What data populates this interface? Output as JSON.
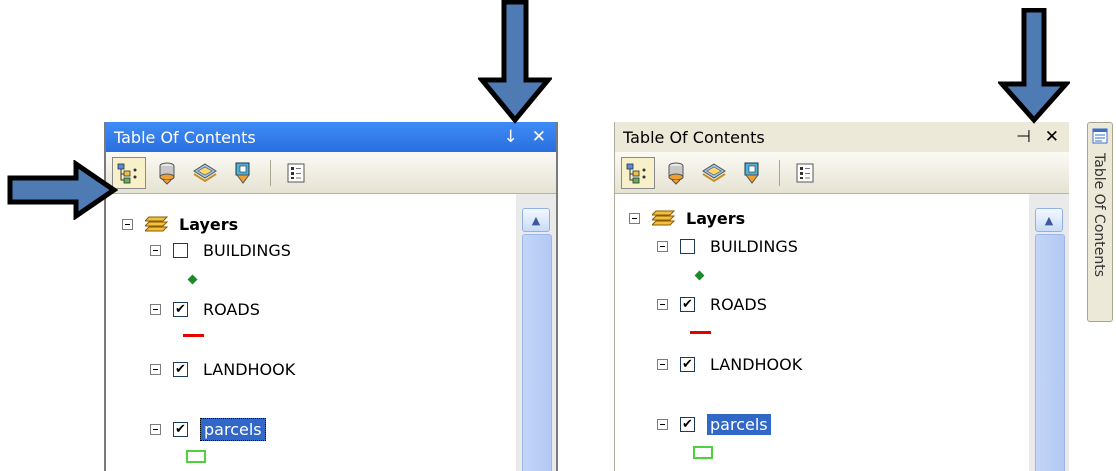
{
  "left_panel": {
    "title": "Table Of Contents",
    "pin_glyph": "↓",
    "close_glyph": "✕",
    "toolbar": [
      "list-by-drawing-order-icon",
      "list-by-source-icon",
      "list-by-visibility-icon",
      "list-by-selection-icon",
      "options-icon"
    ],
    "tree": {
      "root_label": "Layers",
      "layers": [
        {
          "name": "BUILDINGS",
          "checked": false,
          "symbol": "point",
          "symbol_color": "#1b8a2a"
        },
        {
          "name": "ROADS",
          "checked": true,
          "symbol": "line",
          "symbol_color": "#e60000"
        },
        {
          "name": "LANDHOOK",
          "checked": true,
          "symbol": "none"
        },
        {
          "name": "parcels",
          "checked": true,
          "symbol": "polygon",
          "symbol_color": "#4fd13c"
        }
      ]
    },
    "check_glyph": "✔"
  },
  "right_panel": {
    "title": "Table Of Contents",
    "pin_glyph": "⊣",
    "close_glyph": "✕",
    "tree": {
      "root_label": "Layers",
      "layers": [
        {
          "name": "BUILDINGS",
          "checked": false
        },
        {
          "name": "ROADS",
          "checked": true
        },
        {
          "name": "LANDHOOK",
          "checked": true
        },
        {
          "name": "parcels",
          "checked": true
        }
      ]
    },
    "check_glyph": "✔"
  },
  "side_tab": {
    "label": "Table Of Contents"
  },
  "colors": {
    "titlebar_active": "#2a6fe0",
    "titlebar_inactive": "#ece9d8",
    "selection": "#3168c8",
    "arrow_fill": "#4f7bb5",
    "arrow_stroke": "#000000"
  }
}
